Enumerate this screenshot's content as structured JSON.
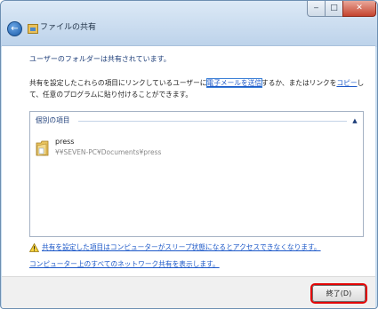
{
  "window": {
    "title": "ファイルの共有",
    "controls": {
      "minimize": "‒",
      "maximize": "□",
      "close": "✕"
    }
  },
  "main": {
    "heading": "ユーザーのフォルダーは共有されています。",
    "desc_part1": "共有を設定したこれらの項目にリンクしているユーザーに",
    "email_link": "電子メールを送信",
    "desc_part2": "するか、またはリンクを",
    "copy_link": "コピー",
    "desc_part3": "して、任意のプログラムに貼り付けることができます。"
  },
  "list": {
    "group_label": "個別の項目",
    "items": [
      {
        "name": "press",
        "path": "¥¥SEVEN-PC¥Documents¥press",
        "icon": "folder-icon"
      }
    ]
  },
  "links": {
    "warning": "共有を設定した項目はコンピューターがスリープ状態になるとアクセスできなくなります。",
    "network": "コンピューター上のすべてのネットワーク共有を表示します。"
  },
  "footer": {
    "finish_label": "終了(D)",
    "highlight_color": "#e20000"
  }
}
